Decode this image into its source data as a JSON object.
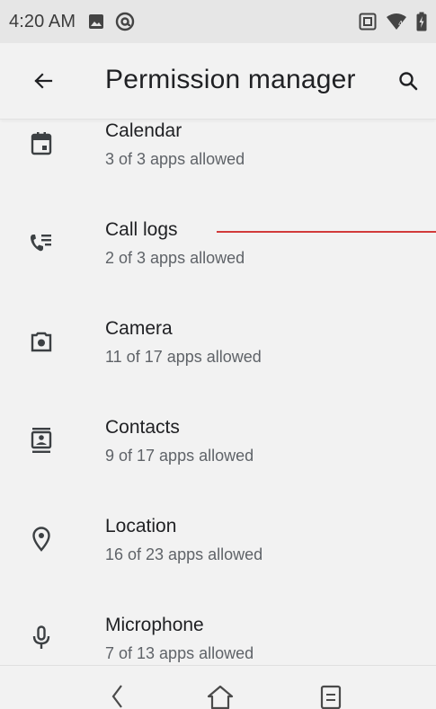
{
  "status_bar": {
    "time": "4:20 AM",
    "left_icons": [
      "image-icon",
      "at-sign-icon"
    ],
    "right_icons": [
      "nfc-icon",
      "wifi-icon",
      "battery-charging-icon"
    ]
  },
  "app_bar": {
    "back_icon": "arrow-back-icon",
    "title": "Permission manager",
    "search_icon": "search-icon"
  },
  "permissions": [
    {
      "icon": "calendar-icon",
      "title": "Calendar",
      "subtitle": "3 of 3 apps allowed"
    },
    {
      "icon": "call-log-icon",
      "title": "Call logs",
      "subtitle": "2 of 3 apps allowed"
    },
    {
      "icon": "camera-icon",
      "title": "Camera",
      "subtitle": "11 of 17 apps allowed"
    },
    {
      "icon": "contacts-icon",
      "title": "Contacts",
      "subtitle": "9 of 17 apps allowed"
    },
    {
      "icon": "location-icon",
      "title": "Location",
      "subtitle": "16 of 23 apps allowed"
    },
    {
      "icon": "microphone-icon",
      "title": "Microphone",
      "subtitle": "7 of 13 apps allowed"
    }
  ],
  "nav_bar": {
    "back": "nav-back-icon",
    "home": "home-icon",
    "recents": "recents-icon"
  },
  "colors": {
    "background": "#f2f2f2",
    "status_bar": "#e6e6e6",
    "text_primary": "#202124",
    "text_secondary": "#5f6368",
    "icon": "#3c4043",
    "annotation_line": "#d23b3b"
  }
}
